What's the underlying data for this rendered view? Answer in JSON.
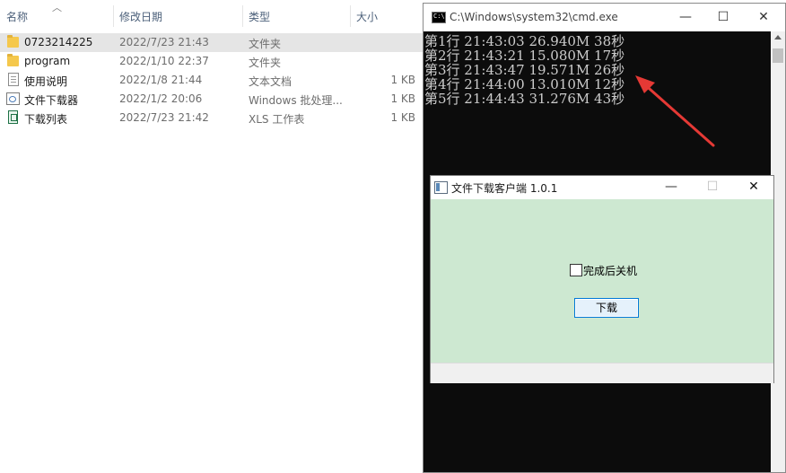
{
  "explorer": {
    "columns": {
      "name": "名称",
      "date": "修改日期",
      "type": "类型",
      "size": "大小"
    },
    "rows": [
      {
        "name": "0723214225",
        "date": "2022/7/23 21:43",
        "type": "文件夹",
        "size": "",
        "icon": "folder-icon",
        "selected": true
      },
      {
        "name": "program",
        "date": "2022/1/10 22:37",
        "type": "文件夹",
        "size": "",
        "icon": "folder-icon"
      },
      {
        "name": "使用说明",
        "date": "2022/1/8 21:44",
        "type": "文本文档",
        "size": "1 KB",
        "icon": "text-file-icon"
      },
      {
        "name": "文件下载器",
        "date": "2022/1/2 20:06",
        "type": "Windows 批处理...",
        "size": "1 KB",
        "icon": "batch-file-icon"
      },
      {
        "name": "下载列表",
        "date": "2022/7/23 21:42",
        "type": "XLS 工作表",
        "size": "1 KB",
        "icon": "xls-file-icon"
      }
    ]
  },
  "cmd": {
    "title": "C:\\Windows\\system32\\cmd.exe",
    "icon_text": "C:\\",
    "lines": [
      "第1行 21:43:03 26.940M 38秒",
      "第2行 21:43:21 15.080M 17秒",
      "第3行 21:43:47 19.571M 26秒",
      "第4行 21:44:00 13.010M 12秒",
      "第5行 21:44:43 31.276M 43秒"
    ],
    "controls": {
      "minimize": "—",
      "maximize": "☐",
      "close": "✕"
    }
  },
  "dialog": {
    "title": "文件下载客户端 1.0.1",
    "checkbox_label": "完成后关机",
    "checkbox_checked": false,
    "button_label": "下载",
    "controls": {
      "minimize": "—",
      "maximize": "☐",
      "close": "✕"
    },
    "background_color": "#cde8d1"
  },
  "colors": {
    "annotation_arrow": "#e53935",
    "console_bg": "#0c0c0c",
    "console_text": "#cccccc"
  }
}
